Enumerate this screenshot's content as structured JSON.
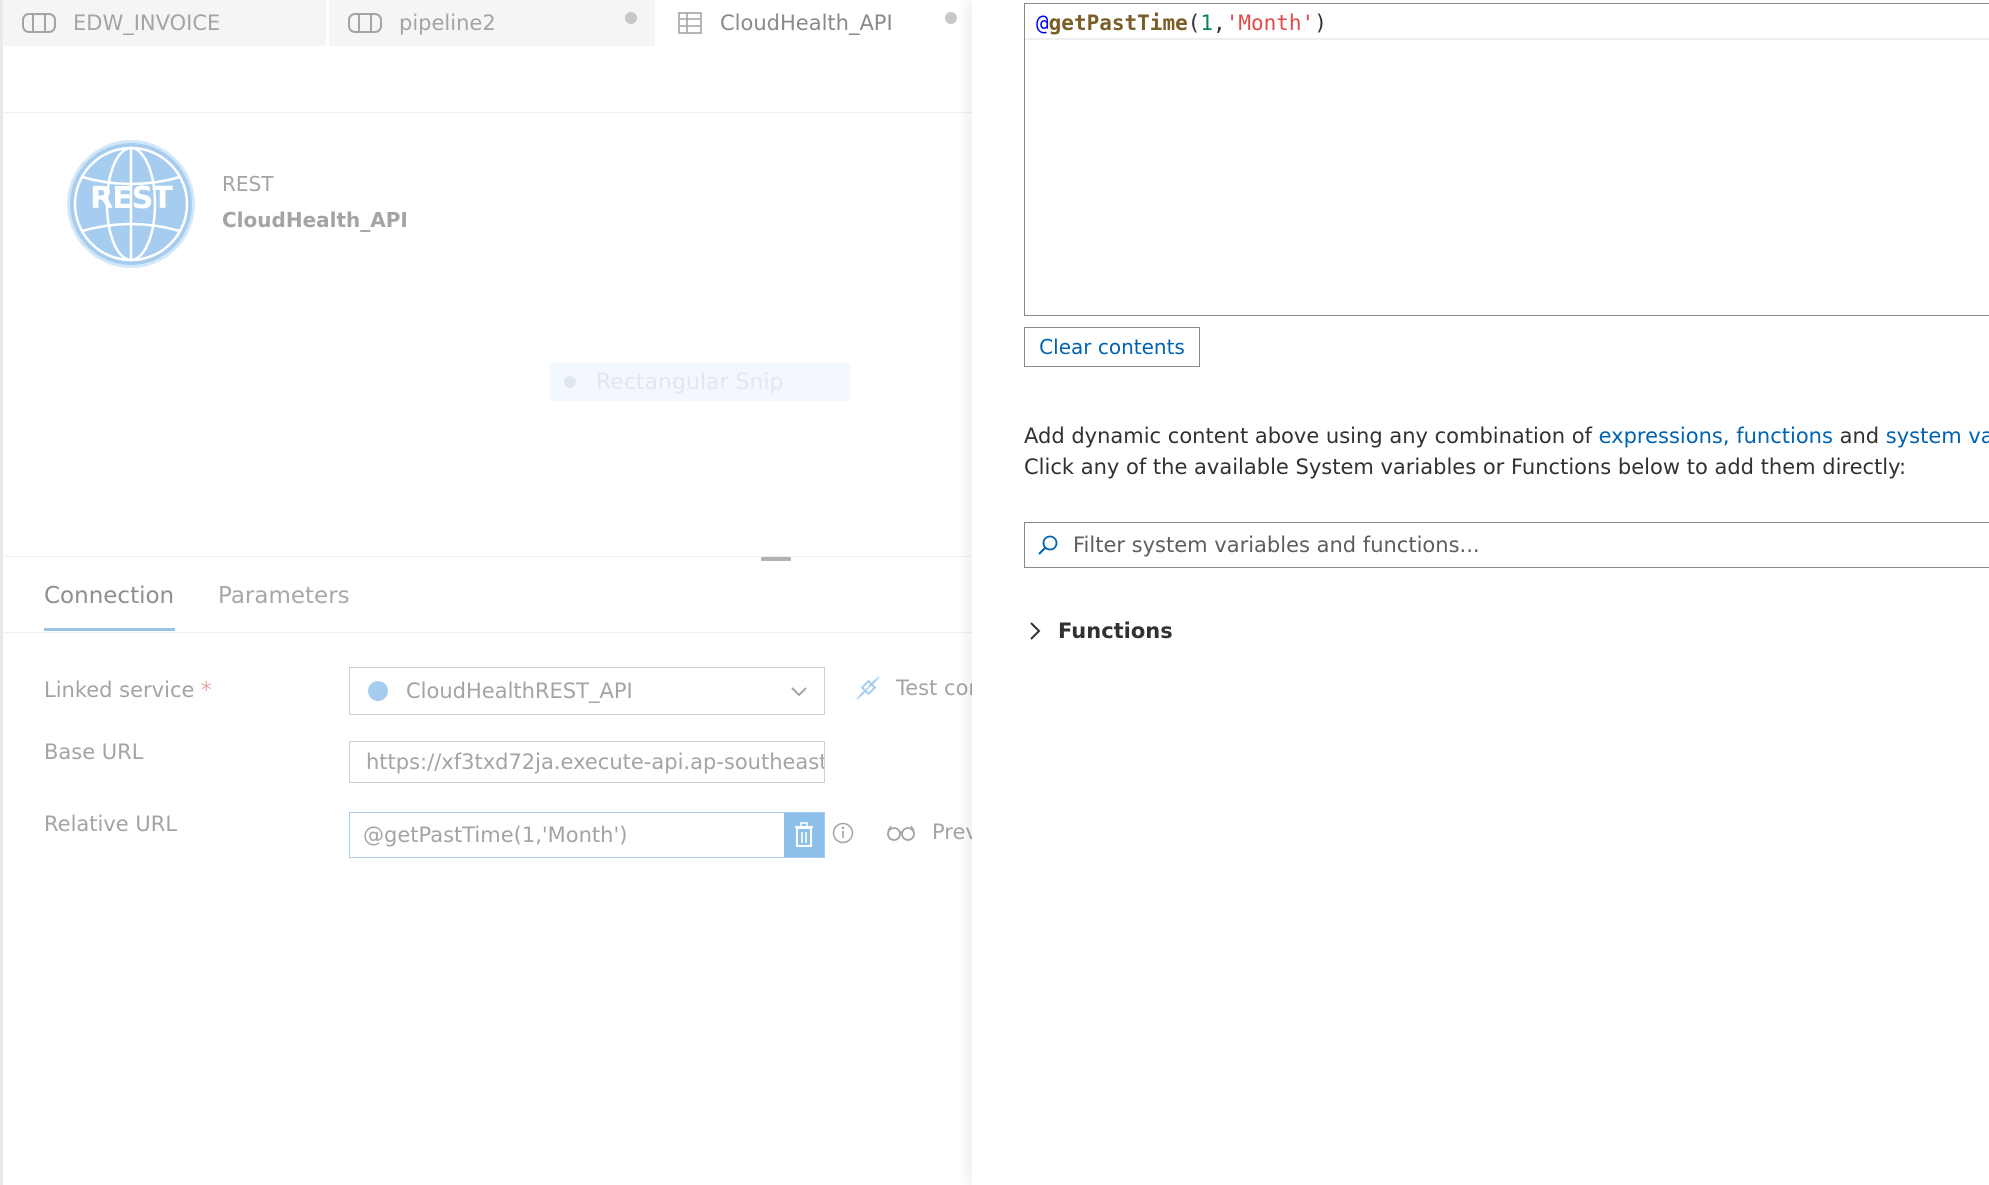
{
  "tabs": [
    {
      "label": "EDW_INVOICE",
      "icon": "pipeline-icon",
      "active": false,
      "dirty": false
    },
    {
      "label": "pipeline2",
      "icon": "pipeline-icon",
      "active": false,
      "dirty": true
    },
    {
      "label": "CloudHealth_API",
      "icon": "dataset-table-icon",
      "active": true,
      "dirty": true
    }
  ],
  "dataset": {
    "logo_text": "REST",
    "type": "REST",
    "name": "CloudHealth_API"
  },
  "overlay": {
    "snip_label": "Rectangular Snip"
  },
  "subtabs": {
    "connection": "Connection",
    "parameters": "Parameters"
  },
  "form": {
    "linked_service_label": "Linked service",
    "required_mark": "*",
    "linked_service_value": "CloudHealthREST_API",
    "test_connection": "Test cor",
    "base_url_label": "Base URL",
    "base_url_value": "https://xf3txd72ja.execute-api.ap-southeast",
    "relative_url_label": "Relative URL",
    "relative_url_value": "@getPastTime(1,'Month')",
    "preview": "Prev"
  },
  "expression": {
    "at": "@",
    "fn": "getPastTime",
    "open": "(",
    "num": "1",
    "comma": ",",
    "str": "'Month'",
    "close": ")"
  },
  "builder": {
    "clear_label": "Clear contents",
    "help_line1_prefix": "Add dynamic content above using any combination of ",
    "help_link1": "expressions, functions",
    "help_and": " and ",
    "help_link2": "system varia",
    "help_line2": "Click any of the available System variables or Functions below to add them directly:",
    "filter_placeholder": "Filter system variables and functions...",
    "functions_label": "Functions"
  },
  "colors": {
    "accent": "#0063b1",
    "rest_blue": "#a6cdf0"
  }
}
